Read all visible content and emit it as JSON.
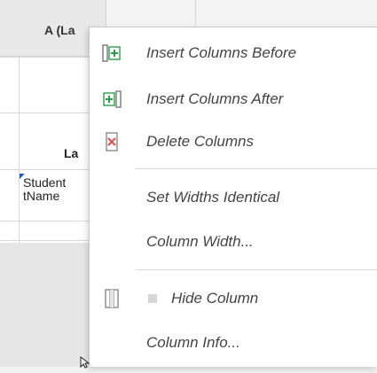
{
  "sheet": {
    "column_header_label": "A (La",
    "cell_la": "La",
    "cell_student_line1": "Student",
    "cell_student_line2": "tName"
  },
  "menu": {
    "items": [
      {
        "label": "Insert Columns Before",
        "icon": "insert-columns-before-icon"
      },
      {
        "label": "Insert Columns After",
        "icon": "insert-columns-after-icon"
      },
      {
        "label": "Delete Columns",
        "icon": "delete-columns-icon"
      },
      {
        "label": "Set Widths Identical",
        "icon": ""
      },
      {
        "label": "Column Width...",
        "icon": ""
      },
      {
        "label": "Hide Column",
        "icon": "hide-column-icon",
        "checked": false
      },
      {
        "label": "Column Info...",
        "icon": ""
      }
    ]
  },
  "colors": {
    "accent_green": "#2e9e4a",
    "delete_red": "#d9534f",
    "menu_text": "#444444"
  }
}
